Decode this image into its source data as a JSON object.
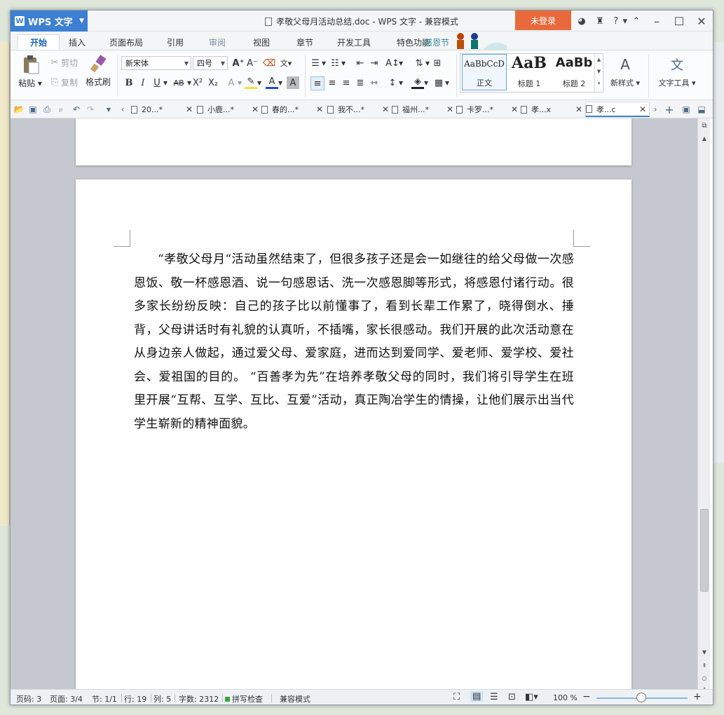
{
  "window": {
    "app_name": "WPS 文字",
    "title": "孝敬父母月活动总结.doc - WPS 文字 - 兼容模式",
    "login_label": "未登录",
    "help_label": "?"
  },
  "menu": {
    "tabs": [
      "开始",
      "插入",
      "页面布局",
      "引用",
      "审阅",
      "视图",
      "章节",
      "开发工具",
      "特色功能"
    ],
    "banner_text": "感恩节"
  },
  "ribbon": {
    "paste": "粘贴",
    "cut": "剪切",
    "copy": "复制",
    "format_painter": "格式刷",
    "font_name": "新宋体",
    "font_size": "四号",
    "bold": "B",
    "italic": "I",
    "underline": "U",
    "strike": "AB",
    "superscript": "X²",
    "subscript": "X₂",
    "styles": [
      {
        "preview": "AaBbCcD",
        "label": "正文"
      },
      {
        "preview": "AaB",
        "label": "标题 1"
      },
      {
        "preview": "AaBb",
        "label": "标题 2"
      }
    ],
    "new_style": "新样式",
    "text_tools": "文字工具"
  },
  "doc_tabs": [
    {
      "label": "20...*"
    },
    {
      "label": "小鹿...*"
    },
    {
      "label": "春的...*"
    },
    {
      "label": "我不...*"
    },
    {
      "label": "福州...*"
    },
    {
      "label": "卡罗...*"
    },
    {
      "label": "孝...x"
    },
    {
      "label": "孝...c"
    }
  ],
  "document": {
    "paragraph": "“孝敬父母月“活动虽然结束了，但很多孩子还是会一如继往的给父母做一次感恩饭、敬一杯感恩酒、说一句感恩话、洗一次感恩脚等形式，将感恩付诸行动。很多家长纷纷反映：自己的孩子比以前懂事了，看到长辈工作累了，晓得倒水、捶背，父母讲话时有礼貌的认真听，不插嘴，家长很感动。我们开展的此次活动意在从身边亲人做起，通过爱父母、爱家庭，进而达到爱同学、爱老师、爱学校、爱社会、爱祖国的目的。 “百善孝为先”在培养孝敬父母的同时，我们将引导学生在班里开展“互帮、互学、互比、互爱”活动，真正陶冶学生的情操，让他们展示出当代学生崭新的精神面貌。"
  },
  "status": {
    "page_code": "页码: 3",
    "pages": "页面: 3/4",
    "section": "节: 1/1",
    "row": "行: 19",
    "col": "列: 5",
    "word_count": "字数: 2312",
    "spell_check": "拼写检查",
    "compat_mode": "兼容模式",
    "zoom": "100 %"
  },
  "colors": {
    "accent": "#3c7fd3",
    "login": "#e8693c"
  }
}
